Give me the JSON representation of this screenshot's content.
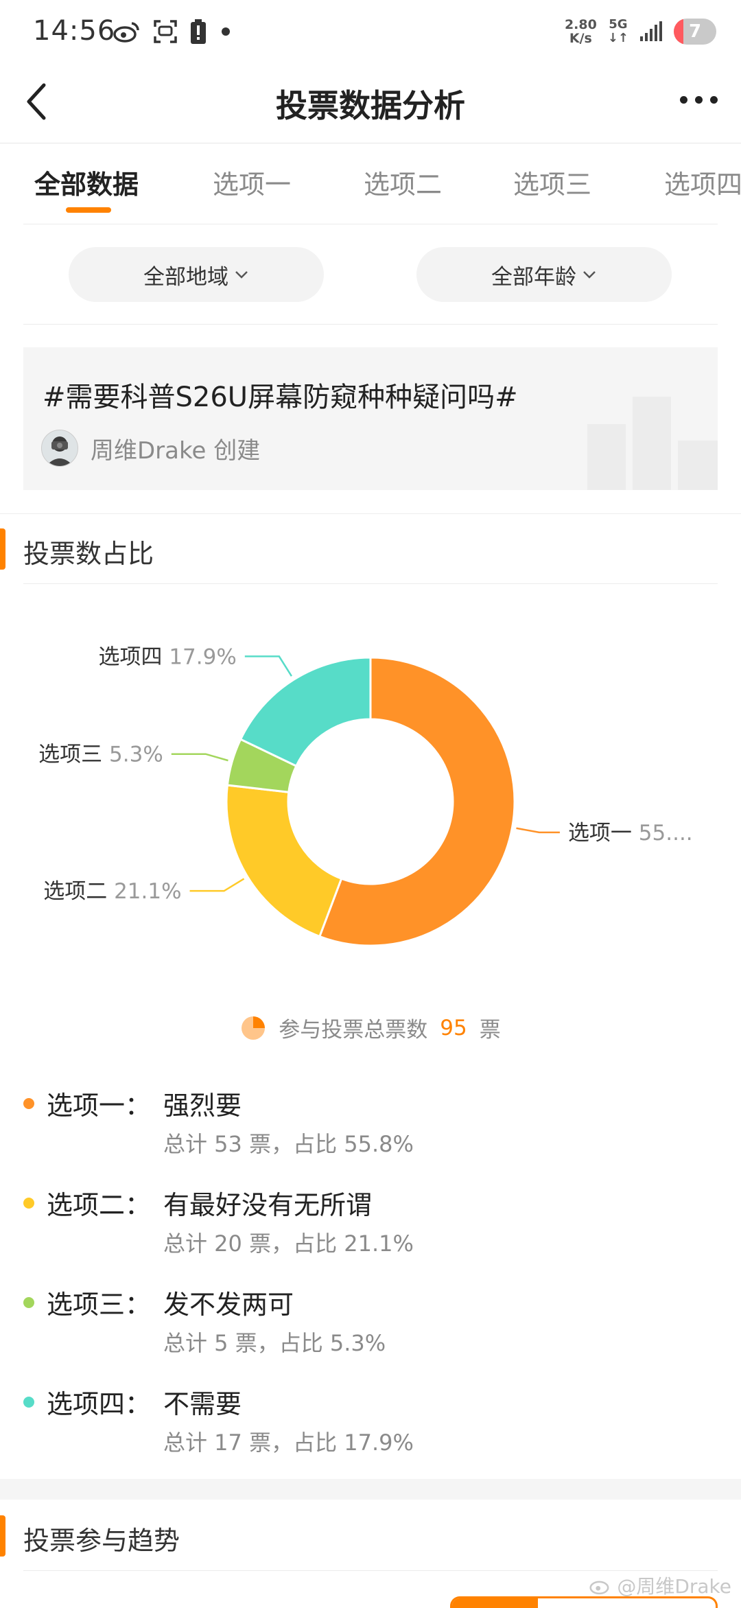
{
  "status_bar": {
    "time": "14:56",
    "net_speed_value": "2.80",
    "net_speed_unit": "K/s",
    "network_type": "5G",
    "battery_level": "7",
    "icons": [
      "weibo-icon",
      "scan-icon",
      "battery-alert-icon",
      "dot-icon",
      "signal-icon"
    ]
  },
  "header": {
    "title": "投票数据分析",
    "back_icon": "chevron-left-icon",
    "more_icon": "more-dots-icon"
  },
  "tabs": [
    {
      "label": "全部数据",
      "active": true
    },
    {
      "label": "选项一",
      "active": false
    },
    {
      "label": "选项二",
      "active": false
    },
    {
      "label": "选项三",
      "active": false
    },
    {
      "label": "选项四",
      "active": false
    }
  ],
  "filters": {
    "region": "全部地域",
    "age": "全部年龄"
  },
  "topic": {
    "title": "#需要科普S26U屏幕防窥种种疑问吗#",
    "creator": "周维Drake 创建"
  },
  "sections": {
    "share_title": "投票数占比",
    "trend_title": "投票参与趋势"
  },
  "chart_data": {
    "type": "pie",
    "style": "donut",
    "series": [
      {
        "name": "选项一",
        "value": 55.8,
        "label_text": "55....",
        "color": "#ff9228"
      },
      {
        "name": "选项二",
        "value": 21.1,
        "label_text": "21.1%",
        "color": "#ffca28"
      },
      {
        "name": "选项三",
        "value": 5.3,
        "label_text": "5.3%",
        "color": "#a3d65c"
      },
      {
        "name": "选项四",
        "value": 17.9,
        "label_text": "17.9%",
        "color": "#57dcc8"
      }
    ]
  },
  "total": {
    "prefix": "参与投票总票数",
    "count": "95",
    "suffix": "票"
  },
  "options": [
    {
      "label": "选项一：",
      "text": "强烈要",
      "detail": "总计 53 票，占比 55.8%",
      "color": "#ff9228"
    },
    {
      "label": "选项二：",
      "text": "有最好没有无所谓",
      "detail": "总计 20 票，占比 21.1%",
      "color": "#ffca28"
    },
    {
      "label": "选项三：",
      "text": "发不发两可",
      "detail": "总计 5 票，占比 5.3%",
      "color": "#a3d65c"
    },
    {
      "label": "选项四：",
      "text": "不需要",
      "detail": "总计 17 票，占比 17.9%",
      "color": "#57dcc8"
    }
  ],
  "watermark": "@周维Drake"
}
